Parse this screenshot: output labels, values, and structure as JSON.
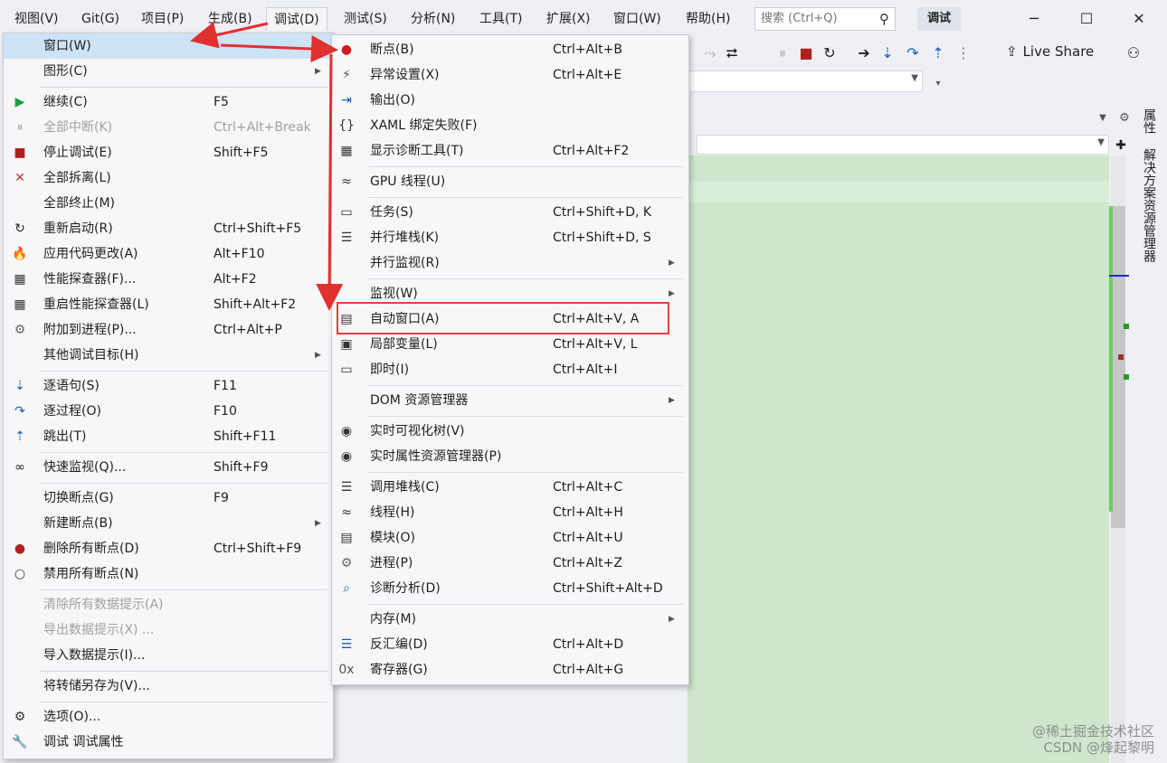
{
  "menubar": {
    "items": [
      "视图(V)",
      "Git(G)",
      "项目(P)",
      "生成(B)",
      "调试(D)",
      "测试(S)",
      "分析(N)",
      "工具(T)",
      "扩展(X)",
      "窗口(W)",
      "帮助(H)"
    ],
    "search_placeholder": "搜索 (Ctrl+Q)",
    "debug_badge": "调试"
  },
  "toolbar": {
    "live_share": "Live Share"
  },
  "side_tabs": [
    "属性",
    "解决方案资源管理器"
  ],
  "watermark": [
    "@稀土掘金技术社区",
    "CSDN @烽起黎明"
  ],
  "debug_menu": [
    {
      "label": "窗口(W)",
      "shortcut": "",
      "icon": "",
      "arrow": true,
      "highlight": true
    },
    {
      "label": "图形(C)",
      "shortcut": "",
      "icon": "",
      "arrow": true
    },
    {
      "sep": true
    },
    {
      "label": "继续(C)",
      "shortcut": "F5",
      "icon": "continue-icon"
    },
    {
      "label": "全部中断(K)",
      "shortcut": "Ctrl+Alt+Break",
      "icon": "pause-icon",
      "disabled": true
    },
    {
      "label": "停止调试(E)",
      "shortcut": "Shift+F5",
      "icon": "stop-icon"
    },
    {
      "label": "全部拆离(L)",
      "shortcut": "",
      "icon": "detach-icon"
    },
    {
      "label": "全部终止(M)",
      "shortcut": "",
      "icon": ""
    },
    {
      "label": "重新启动(R)",
      "shortcut": "Ctrl+Shift+F5",
      "icon": "restart-icon"
    },
    {
      "label": "应用代码更改(A)",
      "shortcut": "Alt+F10",
      "icon": "flame-icon"
    },
    {
      "label": "性能探查器(F)...",
      "shortcut": "Alt+F2",
      "icon": "profiler-icon"
    },
    {
      "label": "重启性能探查器(L)",
      "shortcut": "Shift+Alt+F2",
      "icon": "profiler-icon"
    },
    {
      "label": "附加到进程(P)...",
      "shortcut": "Ctrl+Alt+P",
      "icon": "gears-icon"
    },
    {
      "label": "其他调试目标(H)",
      "shortcut": "",
      "icon": "",
      "arrow": true
    },
    {
      "sep": true
    },
    {
      "label": "逐语句(S)",
      "shortcut": "F11",
      "icon": "step-into-icon"
    },
    {
      "label": "逐过程(O)",
      "shortcut": "F10",
      "icon": "step-over-icon"
    },
    {
      "label": "跳出(T)",
      "shortcut": "Shift+F11",
      "icon": "step-out-icon"
    },
    {
      "sep": true
    },
    {
      "label": "快速监视(Q)...",
      "shortcut": "Shift+F9",
      "icon": "glasses-icon"
    },
    {
      "sep": true
    },
    {
      "label": "切换断点(G)",
      "shortcut": "F9",
      "icon": ""
    },
    {
      "label": "新建断点(B)",
      "shortcut": "",
      "icon": "",
      "arrow": true
    },
    {
      "label": "删除所有断点(D)",
      "shortcut": "Ctrl+Shift+F9",
      "icon": "delete-breakpoints-icon"
    },
    {
      "label": "禁用所有断点(N)",
      "shortcut": "",
      "icon": "disable-breakpoints-icon"
    },
    {
      "sep": true
    },
    {
      "label": "清除所有数据提示(A)",
      "shortcut": "",
      "icon": "",
      "disabled": true
    },
    {
      "label": "导出数据提示(X) ...",
      "shortcut": "",
      "icon": "",
      "disabled": true
    },
    {
      "label": "导入数据提示(I)...",
      "shortcut": "",
      "icon": ""
    },
    {
      "sep": true
    },
    {
      "label": "将转储另存为(V)...",
      "shortcut": "",
      "icon": ""
    },
    {
      "sep": true
    },
    {
      "label": "选项(O)...",
      "shortcut": "",
      "icon": "gear-icon"
    },
    {
      "label": "调试 调试属性",
      "shortcut": "",
      "icon": "wrench-icon"
    }
  ],
  "window_submenu": [
    {
      "label": "断点(B)",
      "shortcut": "Ctrl+Alt+B",
      "icon": "breakpoint-icon"
    },
    {
      "label": "异常设置(X)",
      "shortcut": "Ctrl+Alt+E",
      "icon": "exception-icon"
    },
    {
      "label": "输出(O)",
      "shortcut": "",
      "icon": "output-icon"
    },
    {
      "label": "XAML 绑定失败(F)",
      "shortcut": "",
      "icon": "xaml-icon"
    },
    {
      "label": "显示诊断工具(T)",
      "shortcut": "Ctrl+Alt+F2",
      "icon": "diagnostics-icon"
    },
    {
      "sep": true
    },
    {
      "label": "GPU 线程(U)",
      "shortcut": "",
      "icon": "gpu-threads-icon"
    },
    {
      "sep": true
    },
    {
      "label": "任务(S)",
      "shortcut": "Ctrl+Shift+D, K",
      "icon": "clipboard-icon"
    },
    {
      "label": "并行堆栈(K)",
      "shortcut": "Ctrl+Shift+D, S",
      "icon": "parallel-stacks-icon"
    },
    {
      "label": "并行监视(R)",
      "shortcut": "",
      "icon": "",
      "arrow": true
    },
    {
      "sep": true
    },
    {
      "label": "监视(W)",
      "shortcut": "",
      "icon": "",
      "arrow": true
    },
    {
      "label": "自动窗口(A)",
      "shortcut": "Ctrl+Alt+V, A",
      "icon": "autos-icon"
    },
    {
      "label": "局部变量(L)",
      "shortcut": "Ctrl+Alt+V, L",
      "icon": "locals-icon"
    },
    {
      "label": "即时(I)",
      "shortcut": "Ctrl+Alt+I",
      "icon": "immediate-icon"
    },
    {
      "sep": true
    },
    {
      "label": "DOM 资源管理器",
      "shortcut": "",
      "icon": "",
      "arrow": true
    },
    {
      "sep": true
    },
    {
      "label": "实时可视化树(V)",
      "shortcut": "",
      "icon": "camera-icon"
    },
    {
      "label": "实时属性资源管理器(P)",
      "shortcut": "",
      "icon": "camera-icon"
    },
    {
      "sep": true
    },
    {
      "label": "调用堆栈(C)",
      "shortcut": "Ctrl+Alt+C",
      "icon": "call-stack-icon"
    },
    {
      "label": "线程(H)",
      "shortcut": "Ctrl+Alt+H",
      "icon": "threads-icon"
    },
    {
      "label": "模块(O)",
      "shortcut": "Ctrl+Alt+U",
      "icon": "modules-icon"
    },
    {
      "label": "进程(P)",
      "shortcut": "Ctrl+Alt+Z",
      "icon": "gears-icon"
    },
    {
      "label": "诊断分析(D)",
      "shortcut": "Ctrl+Shift+Alt+D",
      "icon": "diagnostic-analysis-icon"
    },
    {
      "sep": true
    },
    {
      "label": "内存(M)",
      "shortcut": "",
      "icon": "",
      "arrow": true
    },
    {
      "label": "反汇编(D)",
      "shortcut": "Ctrl+Alt+D",
      "icon": "disassembly-icon"
    },
    {
      "label": "寄存器(G)",
      "shortcut": "Ctrl+Alt+G",
      "icon": "registers-icon"
    }
  ]
}
